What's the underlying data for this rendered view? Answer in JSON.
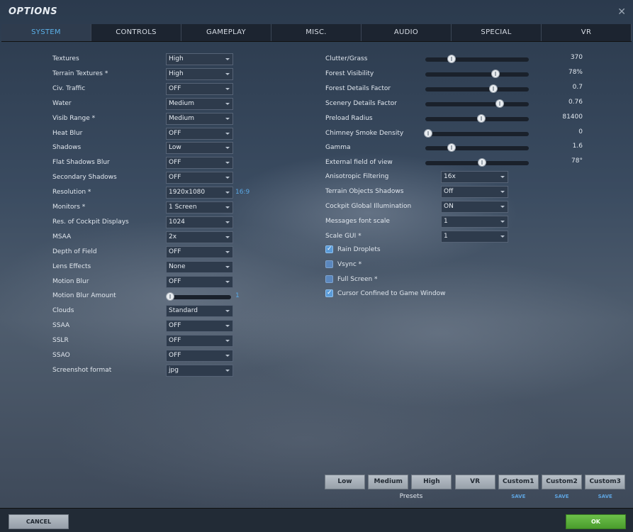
{
  "window": {
    "title": "OPTIONS"
  },
  "tabs": [
    "SYSTEM",
    "CONTROLS",
    "GAMEPLAY",
    "MISC.",
    "AUDIO",
    "SPECIAL",
    "VR"
  ],
  "left_settings": [
    {
      "label": "Textures",
      "value": "High"
    },
    {
      "label": "Terrain Textures *",
      "value": "High"
    },
    {
      "label": "Civ. Traffic",
      "value": "OFF"
    },
    {
      "label": "Water",
      "value": "Medium"
    },
    {
      "label": "Visib Range *",
      "value": "Medium"
    },
    {
      "label": "Heat Blur",
      "value": "OFF"
    },
    {
      "label": "Shadows",
      "value": "Low"
    },
    {
      "label": "Flat Shadows Blur",
      "value": "OFF"
    },
    {
      "label": "Secondary Shadows",
      "value": "OFF"
    },
    {
      "label": "Resolution *",
      "value": "1920x1080"
    },
    {
      "label": "Monitors *",
      "value": "1 Screen"
    },
    {
      "label": "Res. of Cockpit Displays",
      "value": "1024"
    },
    {
      "label": "MSAA",
      "value": "2x"
    },
    {
      "label": "Depth of Field",
      "value": "OFF"
    },
    {
      "label": "Lens Effects",
      "value": "None"
    },
    {
      "label": "Motion Blur",
      "value": "OFF"
    },
    {
      "label": "Motion Blur Amount",
      "value": "1",
      "slider_fraction": 0.0
    },
    {
      "label": "Clouds",
      "value": "Standard"
    },
    {
      "label": "SSAA",
      "value": "OFF"
    },
    {
      "label": "SSLR",
      "value": "OFF"
    },
    {
      "label": "SSAO",
      "value": "OFF"
    },
    {
      "label": "Screenshot format",
      "value": "jpg"
    }
  ],
  "resolution_ratio": "16:9",
  "right_sliders": [
    {
      "label": "Clutter/Grass",
      "value": "370",
      "fraction": 0.25
    },
    {
      "label": "Forest Visibility",
      "value": "78%",
      "fraction": 0.68
    },
    {
      "label": "Forest Details Factor",
      "value": "0.7",
      "fraction": 0.66
    },
    {
      "label": "Scenery Details Factor",
      "value": "0.76",
      "fraction": 0.72
    },
    {
      "label": "Preload Radius",
      "value": "81400",
      "fraction": 0.54
    },
    {
      "label": "Chimney Smoke Density",
      "value": "0",
      "fraction": 0.0
    },
    {
      "label": "Gamma",
      "value": "1.6",
      "fraction": 0.25
    },
    {
      "label": "External field of view",
      "value": "78°",
      "fraction": 0.55
    }
  ],
  "right_dropdowns": [
    {
      "label": "Anisotropic Filtering",
      "value": "16x"
    },
    {
      "label": "Terrain Objects Shadows",
      "value": "Off"
    },
    {
      "label": "Cockpit Global Illumination",
      "value": "ON"
    },
    {
      "label": "Messages font scale",
      "value": "1"
    },
    {
      "label": "Scale GUI *",
      "value": "1"
    }
  ],
  "checkboxes": [
    {
      "label": "Rain Droplets",
      "checked": true
    },
    {
      "label": "Vsync *",
      "checked": false
    },
    {
      "label": "Full Screen *",
      "checked": false
    },
    {
      "label": "Cursor Confined to Game Window",
      "checked": true
    }
  ],
  "presets": {
    "label": "Presets",
    "buttons": [
      "Low",
      "Medium",
      "High",
      "VR",
      "Custom1",
      "Custom2",
      "Custom3"
    ],
    "save_label": "SAVE"
  },
  "footer": {
    "cancel": "CANCEL",
    "ok": "OK"
  },
  "icons": {
    "close": "close-icon",
    "dropdown": "chevron-down-icon",
    "check": "checkmark-icon"
  },
  "colors": {
    "accent": "#5bb0e8",
    "ok_button": "#5aae3b",
    "checkbox": "#5b9bd8"
  }
}
